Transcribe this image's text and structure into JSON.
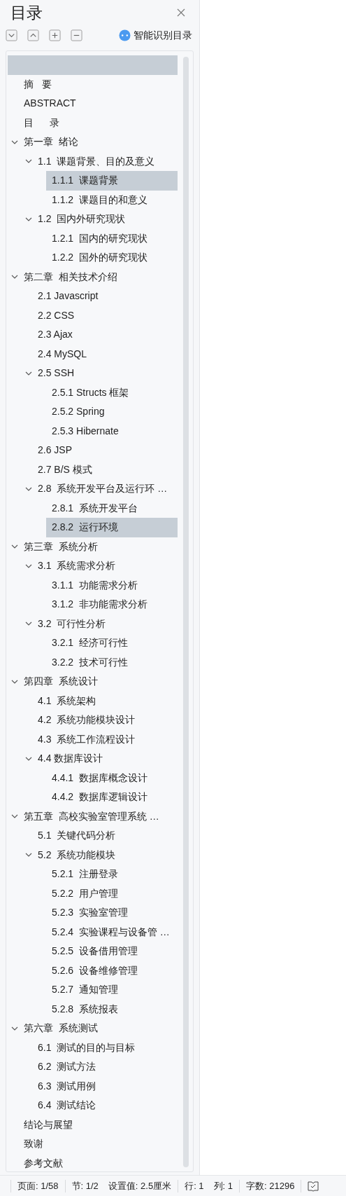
{
  "panel": {
    "title": "目录",
    "toolbar": [
      {
        "kind": "expand-all"
      },
      {
        "kind": "collapse-all"
      },
      {
        "kind": "plus"
      },
      {
        "kind": "minus"
      }
    ],
    "smart_button": "智能识别目录"
  },
  "outline": [
    {
      "selected": true
    },
    {
      "text": "摘   要",
      "selected": false
    },
    {
      "text": "ABSTRACT",
      "selected": false
    },
    {
      "text": "目      录",
      "selected": false
    },
    {
      "text": "第一章  绪论",
      "selected": false,
      "expanded": true,
      "children": [
        {
          "text": "1.1  课题背景、目的及意义",
          "selected": false,
          "expanded": true,
          "children": [
            {
              "text": "1.1.1  课题背景",
              "selected": true
            },
            {
              "text": "1.1.2  课题目的和意义",
              "selected": false
            }
          ]
        },
        {
          "text": "1.2  国内外研究现状",
          "selected": false,
          "expanded": true,
          "children": [
            {
              "text": "1.2.1  国内的研究现状",
              "selected": false
            },
            {
              "text": "1.2.2  国外的研究现状",
              "selected": false
            }
          ]
        }
      ]
    },
    {
      "text": "第二章  相关技术介绍",
      "selected": false,
      "expanded": true,
      "children": [
        {
          "text": "2.1 Javascript",
          "selected": false
        },
        {
          "text": "2.2 CSS",
          "selected": false
        },
        {
          "text": "2.3 Ajax",
          "selected": false
        },
        {
          "text": "2.4 MySQL",
          "selected": false
        },
        {
          "text": "2.5 SSH",
          "selected": false,
          "expanded": true,
          "children": [
            {
              "text": "2.5.1 Structs 框架",
              "selected": false
            },
            {
              "text": "2.5.2 Spring",
              "selected": false
            },
            {
              "text": "2.5.3 Hibernate",
              "selected": false
            }
          ]
        },
        {
          "text": "2.6 JSP",
          "selected": false
        },
        {
          "text": "2.7 B/S 模式",
          "selected": false
        },
        {
          "text": "2.8  系统开发平台及运行环 …",
          "selected": false,
          "expanded": true,
          "children": [
            {
              "text": "2.8.1  系统开发平台",
              "selected": false
            },
            {
              "text": "2.8.2  运行环境",
              "selected": true
            }
          ]
        }
      ]
    },
    {
      "text": "第三章  系统分析",
      "selected": false,
      "expanded": true,
      "children": [
        {
          "text": "3.1  系统需求分析",
          "selected": false,
          "expanded": true,
          "children": [
            {
              "text": "3.1.1  功能需求分析",
              "selected": false
            },
            {
              "text": "3.1.2  非功能需求分析",
              "selected": false
            }
          ]
        },
        {
          "text": "3.2  可行性分析",
          "selected": false,
          "expanded": true,
          "children": [
            {
              "text": "3.2.1  经济可行性",
              "selected": false
            },
            {
              "text": "3.2.2  技术可行性",
              "selected": false
            }
          ]
        }
      ]
    },
    {
      "text": "第四章  系统设计",
      "selected": false,
      "expanded": true,
      "children": [
        {
          "text": "4.1  系统架构",
          "selected": false
        },
        {
          "text": "4.2  系统功能模块设计",
          "selected": false
        },
        {
          "text": "4.3  系统工作流程设计",
          "selected": false
        },
        {
          "text": "4.4 数据库设计",
          "selected": false,
          "expanded": true,
          "children": [
            {
              "text": "4.4.1  数据库概念设计",
              "selected": false
            },
            {
              "text": "4.4.2  数据库逻辑设计",
              "selected": false
            }
          ]
        }
      ]
    },
    {
      "text": "第五章  高校实验室管理系统 …",
      "selected": false,
      "expanded": true,
      "children": [
        {
          "text": "5.1  关键代码分析",
          "selected": false
        },
        {
          "text": "5.2  系统功能模块",
          "selected": false,
          "expanded": true,
          "children": [
            {
              "text": "5.2.1  注册登录",
              "selected": false
            },
            {
              "text": "5.2.2  用户管理",
              "selected": false
            },
            {
              "text": "5.2.3  实验室管理",
              "selected": false
            },
            {
              "text": "5.2.4  实验课程与设备管 …",
              "selected": false
            },
            {
              "text": "5.2.5  设备借用管理",
              "selected": false
            },
            {
              "text": "5.2.6  设备维修管理",
              "selected": false
            },
            {
              "text": "5.2.7  通知管理",
              "selected": false
            },
            {
              "text": "5.2.8  系统报表",
              "selected": false
            }
          ]
        }
      ]
    },
    {
      "text": "第六章  系统测试",
      "selected": false,
      "expanded": true,
      "children": [
        {
          "text": "6.1  测试的目的与目标",
          "selected": false
        },
        {
          "text": "6.2  测试方法",
          "selected": false
        },
        {
          "text": "6.3  测试用例",
          "selected": false
        },
        {
          "text": "6.4  测试结论",
          "selected": false
        }
      ]
    },
    {
      "text": "结论与展望",
      "selected": false
    },
    {
      "text": "致谢",
      "selected": false
    },
    {
      "text": "参考文献",
      "selected": false
    }
  ],
  "status_bar": [
    [
      "页面: 1/58"
    ],
    [
      "节: 1/2",
      "设置值: 2.5厘米"
    ],
    [
      "行: 1",
      "列: 1"
    ],
    [
      "字数: 21296"
    ]
  ]
}
